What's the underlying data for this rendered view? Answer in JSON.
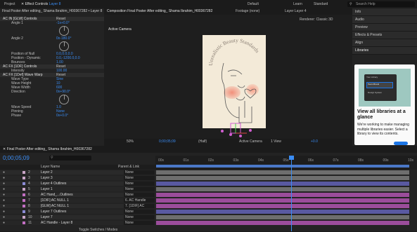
{
  "menu": {
    "left": [
      "Project",
      "Effect Controls",
      "Layer 8"
    ],
    "right": [
      "Default",
      "Learn",
      "Standard",
      "Search Help"
    ]
  },
  "effect_controls": {
    "header": "Final Poster After editing_ Shama Ibrahim_H00367282 • Layer 8",
    "rows": [
      {
        "t": "fx",
        "label": "AC IN [GLW] Controls",
        "value": "Reset"
      },
      {
        "t": "p",
        "label": "Angle 1",
        "value": "-1x+0.0°"
      },
      {
        "t": "p",
        "label": "Angle 2",
        "value": "0x-180.0°"
      },
      {
        "t": "p",
        "label": "Position of Null",
        "value": "0.0,0.0,0.0"
      },
      {
        "t": "p",
        "label": "Position - Dynamic",
        "value": "0.0,-1200.0,0.0"
      },
      {
        "t": "p",
        "label": "Bounces",
        "value": "1.00"
      },
      {
        "t": "fx",
        "label": "AC FX [1DF] Controls",
        "value": "Reset"
      },
      {
        "t": "p",
        "label": "Intensity",
        "value": "100.00"
      },
      {
        "t": "fx",
        "label": "AC FX [1Def] Wave Warp",
        "value": "Reset"
      },
      {
        "t": "p",
        "label": "Wave Type",
        "value": "Sine"
      },
      {
        "t": "p",
        "label": "Wave Height",
        "value": "10"
      },
      {
        "t": "p",
        "label": "Wave Width",
        "value": "600"
      },
      {
        "t": "p",
        "label": "Direction",
        "value": "0x+90.0°"
      },
      {
        "t": "p",
        "label": "Wave Speed",
        "value": "1.0"
      },
      {
        "t": "p",
        "label": "Pinning",
        "value": "None"
      },
      {
        "t": "p",
        "label": "Phase",
        "value": "0x+0.0°"
      }
    ]
  },
  "composition": {
    "tabs": [
      "Composition Final Poster After editing_ Shama Ibrahim_H00367282",
      "Footage (none)",
      "Layer Layer 4"
    ],
    "renderer_label": "Renderer:",
    "renderer_value": "Classic 3D",
    "camera_label": "Active Camera",
    "poster_text": "Unrealistic Beauty Standards",
    "toolbar": [
      "50%",
      "0;00;05;09",
      "(Half)",
      "Active Camera",
      "1 View",
      "+0.0"
    ]
  },
  "right_panel": {
    "items": [
      "Info",
      "Audio",
      "Preview",
      "Effects & Presets",
      "Align",
      "Libraries"
    ],
    "lib_title": "View all libraries at a glance",
    "lib_body": "We're working to make managing multiple libraries easier. Select a library to view its contents.",
    "mock_items": [
      "Your Library",
      "Team Brand",
      "Design System"
    ]
  },
  "timeline": {
    "title": "Final Poster After editing_ Shama Ibrahim_H00367282",
    "timecode": "0;00;05;09",
    "col_headers": [
      "Layer Name",
      "Parent & Link"
    ],
    "ruler": [
      "00s",
      "01s",
      "02s",
      "03s",
      "04s",
      "05s",
      "06s",
      "07s",
      "08s",
      "09s",
      "10s"
    ],
    "layers": [
      {
        "n": "2",
        "name": "Layer 2",
        "parent": "None",
        "color": "#c9a5c6",
        "bar": "#6e6e6e"
      },
      {
        "n": "3",
        "name": "Layer 3",
        "parent": "None",
        "color": "#c9a5c6",
        "bar": "#6e6e6e"
      },
      {
        "n": "4",
        "name": "Layer 4 Outlines",
        "parent": "None",
        "color": "#8c8cd6",
        "bar": "#5959a1"
      },
      {
        "n": "5",
        "name": "Layer 1",
        "parent": "None",
        "color": "#c9a5c6",
        "bar": "#6e6e6e"
      },
      {
        "n": "6",
        "name": "AC Hand_...Outlines",
        "parent": "None",
        "color": "#c36fc3",
        "bar": "#9b4d9b"
      },
      {
        "n": "7",
        "name": "[1DIF] AC NULL 1",
        "parent": "6. AC Handle",
        "color": "#c36fc3",
        "bar": "#9b4d9b"
      },
      {
        "n": "8",
        "name": "[GLW] AC NULL 1",
        "parent": "7. [1DIF] AC",
        "color": "#c36fc3",
        "bar": "#9b4d9b"
      },
      {
        "n": "9",
        "name": "Layer 7 Outlines",
        "parent": "None",
        "color": "#8c8cd6",
        "bar": "#5959a1"
      },
      {
        "n": "10",
        "name": "Layer 7",
        "parent": "None",
        "color": "#c9a5c6",
        "bar": "#6e6e6e"
      },
      {
        "n": "11",
        "name": "AC Handle - Layer 8",
        "parent": "None",
        "color": "#c36fc3",
        "bar": "#9b4d9b"
      }
    ],
    "footer": "Toggle Switches / Modes"
  }
}
